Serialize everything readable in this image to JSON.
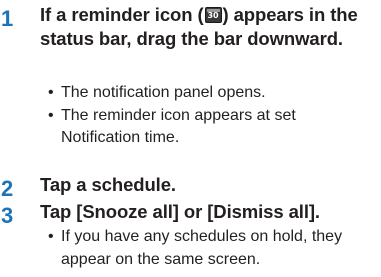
{
  "steps": [
    {
      "number": "1",
      "title_before_icon": "If a reminder icon (",
      "title_after_icon": ") appears in the status bar, drag the bar downward.",
      "icon": {
        "name": "reminder-calendar-icon",
        "text": "30"
      },
      "bullets": [
        "The notification panel opens.",
        "The reminder icon appears at set Notification time."
      ]
    },
    {
      "number": "2",
      "title": "Tap a schedule.",
      "bullets": []
    },
    {
      "number": "3",
      "title": "Tap [Snooze all] or [Dismiss all].",
      "bullets": [
        "If you have any schedules on hold, they appear on the same screen."
      ]
    }
  ],
  "bullet_glyph": "•",
  "colors": {
    "step_number": "#1c73b8",
    "text": "#231f20"
  }
}
